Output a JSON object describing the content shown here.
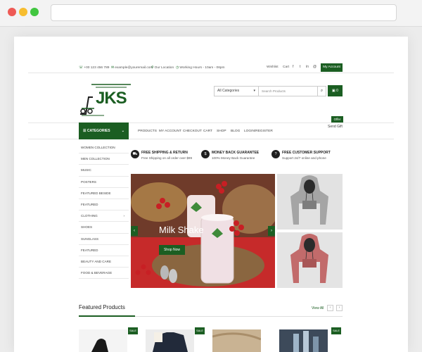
{
  "browser": {
    "url": ""
  },
  "topbar": {
    "phone": "+00 123 456 789",
    "email": "example@youremail.com",
    "location": "Our Location",
    "hours": "Working Hours - 10am - 06pm",
    "wishlist": "Wishlist",
    "cart": "Cart",
    "social": [
      "f",
      "t",
      "in",
      "@"
    ],
    "account": "My Account"
  },
  "header": {
    "logo_text": "JKS",
    "category_select": "All Categories",
    "search_placeholder": "Search Products",
    "cart_count": "0",
    "offer_badge": "Offer",
    "send_gift": "Send Gift"
  },
  "nav": {
    "categories_label": "CATEGORIES",
    "items": [
      "PRODUCTS",
      "MY ACCOUNT",
      "CHECKOUT",
      "CART",
      "SHOP",
      "BLOG",
      "LOGIN/REGISTER"
    ]
  },
  "sidebar": {
    "items": [
      "WOMEN COLLECTION",
      "MEN COLLECTION",
      "MUSIC",
      "POSTERS",
      "FEATURED BESIDE",
      "FEATURED",
      "CLOTHING",
      "SHOES",
      "SUNGLASS",
      "FEATURED",
      "BEAUTY AND CARE",
      "FOOD & BEVERAGE"
    ]
  },
  "features": [
    {
      "title": "FREE SHIPPING & RETURN",
      "subtitle": "Free Shipping on all order over $99",
      "icon": "truck-icon"
    },
    {
      "title": "MONEY BACK GUARANTEE",
      "subtitle": "100% Money Back Guarantee",
      "icon": "money-icon"
    },
    {
      "title": "FREE CUSTOMER SUPPORT",
      "subtitle": "Support 24/7 online and phone",
      "icon": "support-icon"
    }
  ],
  "hero": {
    "title": "Milk Shake",
    "button": "Shop Now"
  },
  "featured": {
    "title": "Featured Products",
    "view_all": "View All",
    "sale_label": "SALE"
  },
  "colors": {
    "brand_green": "#1b5e22",
    "accent_dark": "#1f1f1f"
  }
}
